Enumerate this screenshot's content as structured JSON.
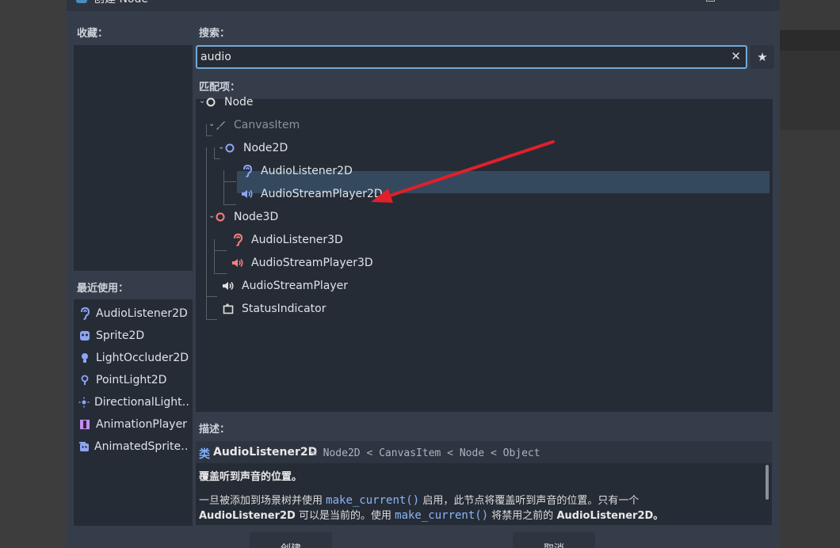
{
  "window": {
    "title": "创建 Node",
    "minimize": "□",
    "close": "✕"
  },
  "favorites": {
    "label": "收藏："
  },
  "recent": {
    "label": "最近使用：",
    "items": [
      {
        "label": "AudioListener2D",
        "icon": "ear-icon",
        "color": "#8da5f3"
      },
      {
        "label": "Sprite2D",
        "icon": "sprite-icon",
        "color": "#8da5f3"
      },
      {
        "label": "LightOccluder2D",
        "icon": "occluder-icon",
        "color": "#8da5f3"
      },
      {
        "label": "PointLight2D",
        "icon": "light-icon",
        "color": "#8da5f3"
      },
      {
        "label": "DirectionalLight…",
        "icon": "sun-icon",
        "color": "#8da5f3"
      },
      {
        "label": "AnimationPlayer",
        "icon": "film-icon",
        "color": "#c38ef1"
      },
      {
        "label": "AnimatedSprite…",
        "icon": "animated-sprite-icon",
        "color": "#8da5f3"
      }
    ]
  },
  "search": {
    "label": "搜索：",
    "value": "audio",
    "clear": "✕",
    "favorite": "★"
  },
  "matches": {
    "label": "匹配项：",
    "tree": [
      {
        "label": "Node",
        "icon": "circle-icon",
        "color": "#e0e0e0",
        "level": 0,
        "expand": "⌄"
      },
      {
        "label": "CanvasItem",
        "icon": "brush-icon",
        "color": "#8a9099",
        "level": 1,
        "expand": "⌄",
        "disabled": true
      },
      {
        "label": "Node2D",
        "icon": "circle-icon",
        "color": "#8da5f3",
        "level": 2,
        "expand": "⌄"
      },
      {
        "label": "AudioListener2D",
        "icon": "ear-icon",
        "color": "#8da5f3",
        "level": 3,
        "selected": true
      },
      {
        "label": "AudioStreamPlayer2D",
        "icon": "speaker-icon",
        "color": "#8da5f3",
        "level": 3
      },
      {
        "label": "Node3D",
        "icon": "circle-icon",
        "color": "#fc7f7f",
        "level": 1,
        "expand": "⌄"
      },
      {
        "label": "AudioListener3D",
        "icon": "ear-icon",
        "color": "#fc7f7f",
        "level": 2
      },
      {
        "label": "AudioStreamPlayer3D",
        "icon": "speaker-icon",
        "color": "#fc7f7f",
        "level": 2
      },
      {
        "label": "AudioStreamPlayer",
        "icon": "speaker-icon",
        "color": "#e0e0e0",
        "level": 1
      },
      {
        "label": "StatusIndicator",
        "icon": "status-icon",
        "color": "#e0e0e0",
        "level": 1
      }
    ]
  },
  "description": {
    "label": "描述：",
    "keyword": "类",
    "class_name": "AudioListener2D",
    "inheritance": "< Node2D < CanvasItem < Node < Object",
    "brief": "覆盖听到声音的位置。",
    "body_1": "一旦被添加到场景树并使用",
    "code_1": "make_current()",
    "body_2": "启用，此节点将覆盖听到声音的位置。只有一个",
    "bold_1": "AudioListener2D",
    "body_3": "可以是当前的。使用",
    "code_2": "make_current()",
    "body_4": "将禁用之前的",
    "bold_2": "AudioListener2D。"
  },
  "buttons": {
    "create": "创建",
    "cancel": "取消"
  },
  "colors": {
    "accent": "#74a9d8",
    "arrow": "#e0202a",
    "selection": "#34495e"
  }
}
